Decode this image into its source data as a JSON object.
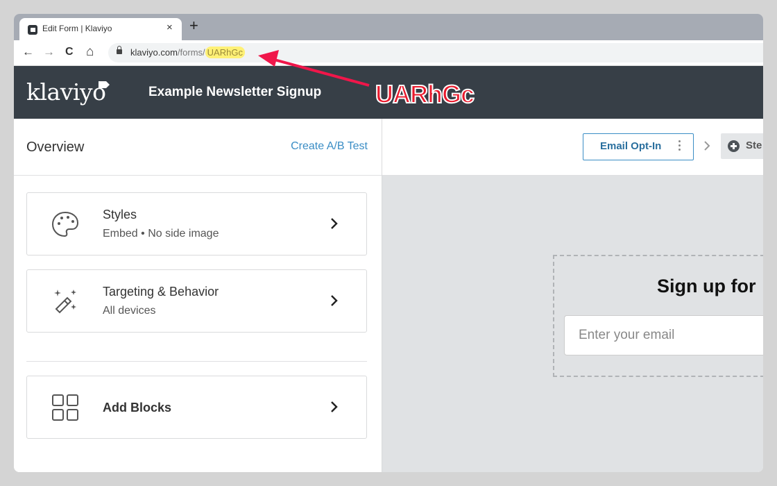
{
  "browser": {
    "tab_title": "Edit Form | Klaviyo",
    "close_glyph": "×",
    "new_tab_glyph": "+",
    "nav": {
      "back": "←",
      "forward": "→",
      "reload": "C",
      "home": "⌂"
    },
    "url_domain": "klaviyo.com",
    "url_path": "/forms/",
    "url_highlight": "UARhGc"
  },
  "header": {
    "logo": "klaviyo",
    "form_title": "Example Newsletter Signup",
    "annotation": "UARhGc",
    "annotation_color": "#e8192c"
  },
  "left_panel": {
    "title": "Overview",
    "ab_test_link": "Create A/B Test",
    "cards": [
      {
        "title": "Styles",
        "subtitle": "Embed • No side image",
        "icon": "palette-icon"
      },
      {
        "title": "Targeting & Behavior",
        "subtitle": "All devices",
        "icon": "magic-wand-icon"
      },
      {
        "title": "Add Blocks",
        "subtitle": "",
        "icon": "grid-icon"
      }
    ]
  },
  "preview": {
    "step_button": "Email Opt-In",
    "add_step_label": "Ste",
    "signup_heading": "Sign up for",
    "email_placeholder": "Enter your email"
  },
  "colors": {
    "header_bg": "#373f47",
    "link": "#3a8dc5",
    "url_highlight": "#fff176",
    "canvas_bg": "#e0e2e4"
  }
}
